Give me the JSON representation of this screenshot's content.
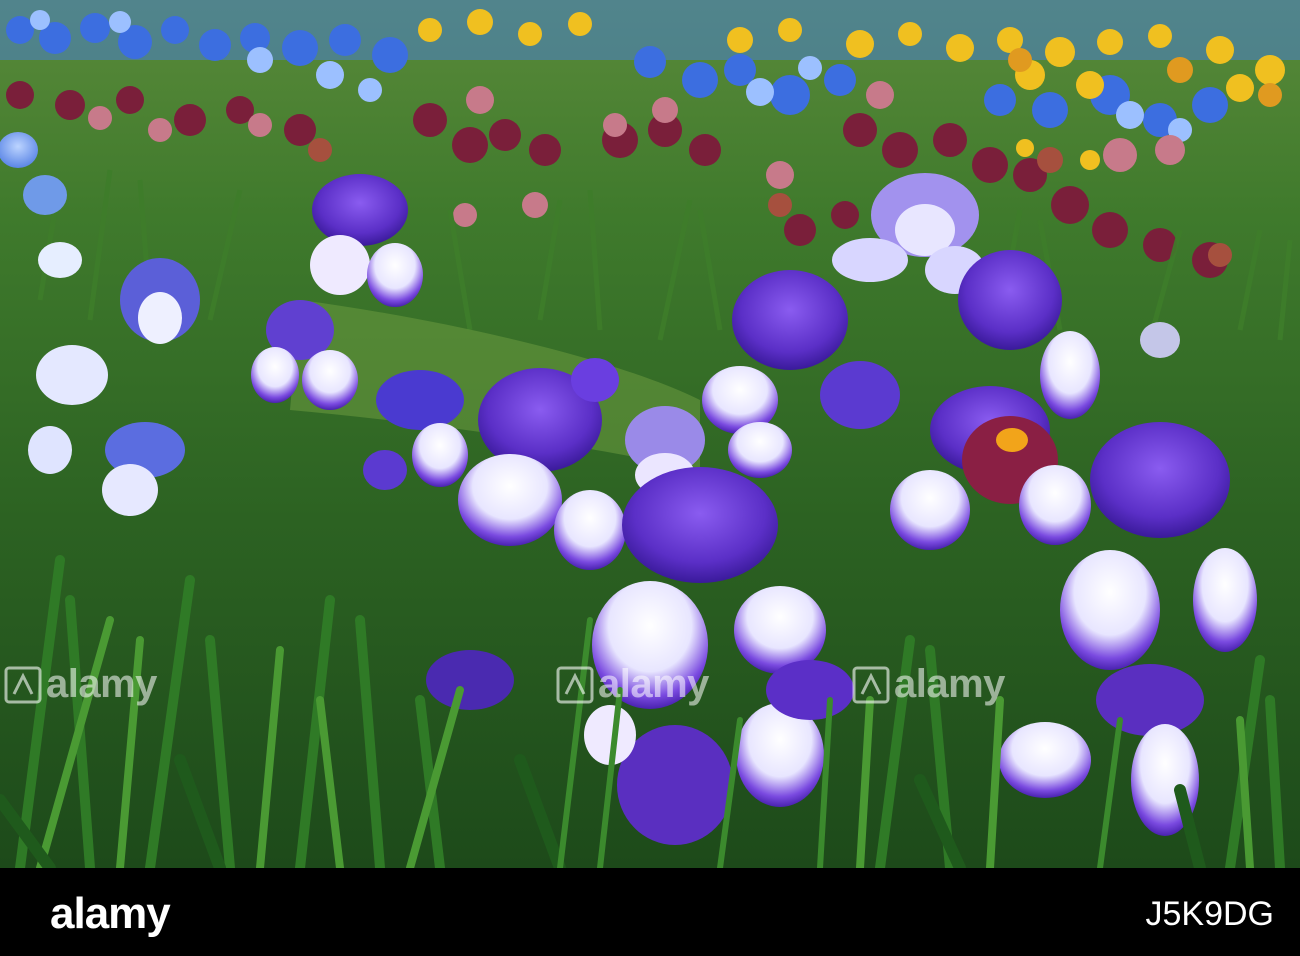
{
  "image": {
    "subject": "iris-flower-field",
    "colors": {
      "foliage_dark": "#1d4a1a",
      "foliage_mid": "#3f7f2c",
      "foliage_light": "#6ea63f",
      "iris_purple": "#5b2fc7",
      "iris_violet": "#7a45e0",
      "iris_white": "#eef0ff",
      "iris_blue": "#4a7de6",
      "iris_yellow": "#f0c020",
      "iris_maroon": "#7a1f3a",
      "iris_pink": "#c77a8a",
      "beard_orange": "#f2a41a"
    }
  },
  "watermark": {
    "text": "alamy",
    "icon": "alamy-logo-icon"
  },
  "footer": {
    "logo_text": "alamy",
    "image_id": "J5K9DG"
  }
}
